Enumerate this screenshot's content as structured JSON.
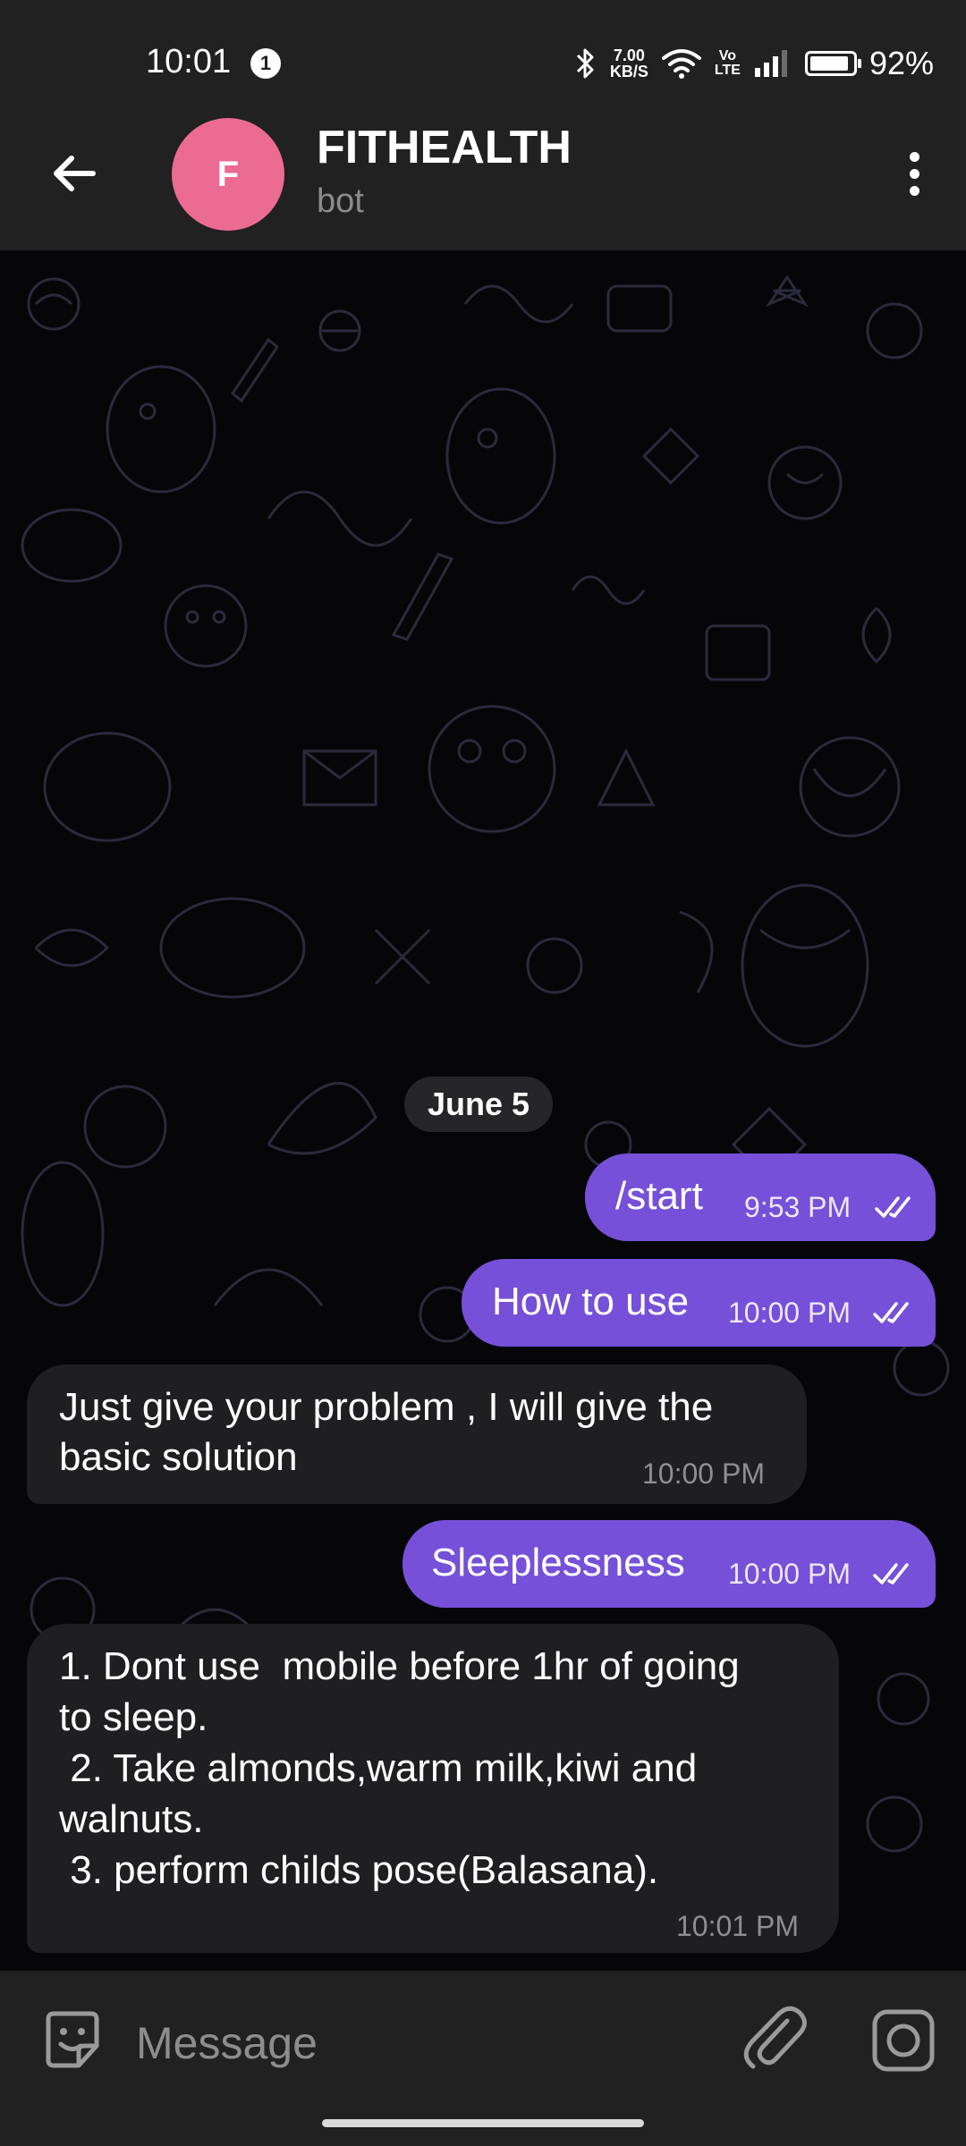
{
  "status_bar": {
    "time": "10:01",
    "notification_count": "1",
    "net_speed_value": "7.00",
    "net_speed_unit": "KB/S",
    "volte_top": "Vo",
    "volte_bottom": "LTE",
    "battery_percent": "92%",
    "battery_level": 0.92
  },
  "header": {
    "avatar_letter": "F",
    "title": "FITHEALTH",
    "subtitle": "bot",
    "avatar_color": "#ec6b93"
  },
  "chat": {
    "date_separator": "June 5",
    "messages": [
      {
        "direction": "out",
        "text": "/start",
        "time": "9:53 PM",
        "read": true
      },
      {
        "direction": "out",
        "text": "How to use",
        "time": "10:00 PM",
        "read": true
      },
      {
        "direction": "in",
        "lines": [
          "Just give your problem , I will give the",
          "basic solution"
        ],
        "time": "10:00 PM"
      },
      {
        "direction": "out",
        "text": "Sleeplessness",
        "time": "10:00 PM",
        "read": true
      },
      {
        "direction": "in",
        "lines": [
          "1. Dont use  mobile before 1hr of going",
          "to sleep.",
          " 2. Take almonds,warm milk,kiwi and",
          "walnuts.",
          " 3. perform childs pose(Balasana)."
        ],
        "time": "10:01 PM"
      }
    ]
  },
  "composer": {
    "placeholder": "Message"
  },
  "colors": {
    "outgoing_bubble": "#7650d8",
    "incoming_bubble": "#1f1f21",
    "bars": "#212121"
  }
}
